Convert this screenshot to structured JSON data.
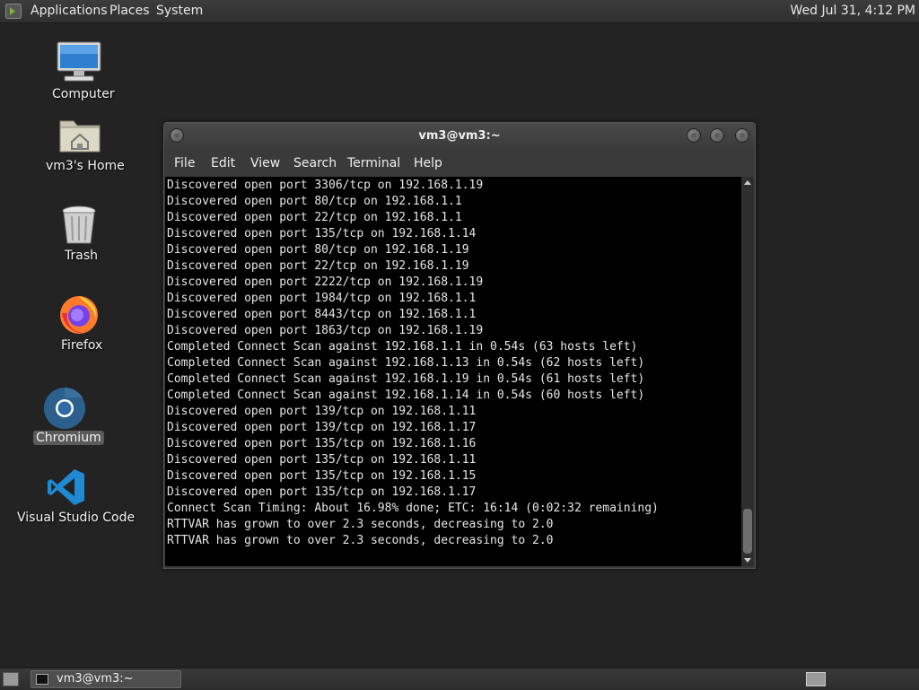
{
  "top_panel": {
    "menus": [
      "Applications",
      "Places",
      "System"
    ],
    "clock": "Wed Jul 31,  4:12 PM"
  },
  "desktop_icons": [
    {
      "label": "Computer",
      "icon": "computer-icon"
    },
    {
      "label": "vm3's Home",
      "icon": "home-folder-icon"
    },
    {
      "label": "Trash",
      "icon": "trash-icon"
    },
    {
      "label": "Firefox",
      "icon": "firefox-icon"
    },
    {
      "label": "Chromium",
      "icon": "chromium-icon",
      "selected": true
    },
    {
      "label": "Visual Studio Code",
      "icon": "vscode-icon"
    }
  ],
  "window": {
    "title": "vm3@vm3:~",
    "menu": [
      "File",
      "Edit",
      "View",
      "Search",
      "Terminal",
      "Help"
    ],
    "lines": [
      "Discovered open port 3306/tcp on 192.168.1.19",
      "Discovered open port 80/tcp on 192.168.1.1",
      "Discovered open port 22/tcp on 192.168.1.1",
      "Discovered open port 135/tcp on 192.168.1.14",
      "Discovered open port 80/tcp on 192.168.1.19",
      "Discovered open port 22/tcp on 192.168.1.19",
      "Discovered open port 2222/tcp on 192.168.1.19",
      "Discovered open port 1984/tcp on 192.168.1.1",
      "Discovered open port 8443/tcp on 192.168.1.1",
      "Discovered open port 1863/tcp on 192.168.1.19",
      "Completed Connect Scan against 192.168.1.1 in 0.54s (63 hosts left)",
      "Completed Connect Scan against 192.168.1.13 in 0.54s (62 hosts left)",
      "Completed Connect Scan against 192.168.1.19 in 0.54s (61 hosts left)",
      "Completed Connect Scan against 192.168.1.14 in 0.54s (60 hosts left)",
      "Discovered open port 139/tcp on 192.168.1.11",
      "Discovered open port 139/tcp on 192.168.1.17",
      "Discovered open port 135/tcp on 192.168.1.16",
      "Discovered open port 135/tcp on 192.168.1.11",
      "Discovered open port 135/tcp on 192.168.1.15",
      "Discovered open port 135/tcp on 192.168.1.17",
      "Connect Scan Timing: About 16.98% done; ETC: 16:14 (0:02:32 remaining)",
      "RTTVAR has grown to over 2.3 seconds, decreasing to 2.0",
      "RTTVAR has grown to over 2.3 seconds, decreasing to 2.0"
    ]
  },
  "taskbar": {
    "task_label": "vm3@vm3:~"
  },
  "colors": {
    "desktop_bg": "#232323",
    "terminal_bg": "#000000",
    "terminal_fg": "#e6e6e6"
  }
}
